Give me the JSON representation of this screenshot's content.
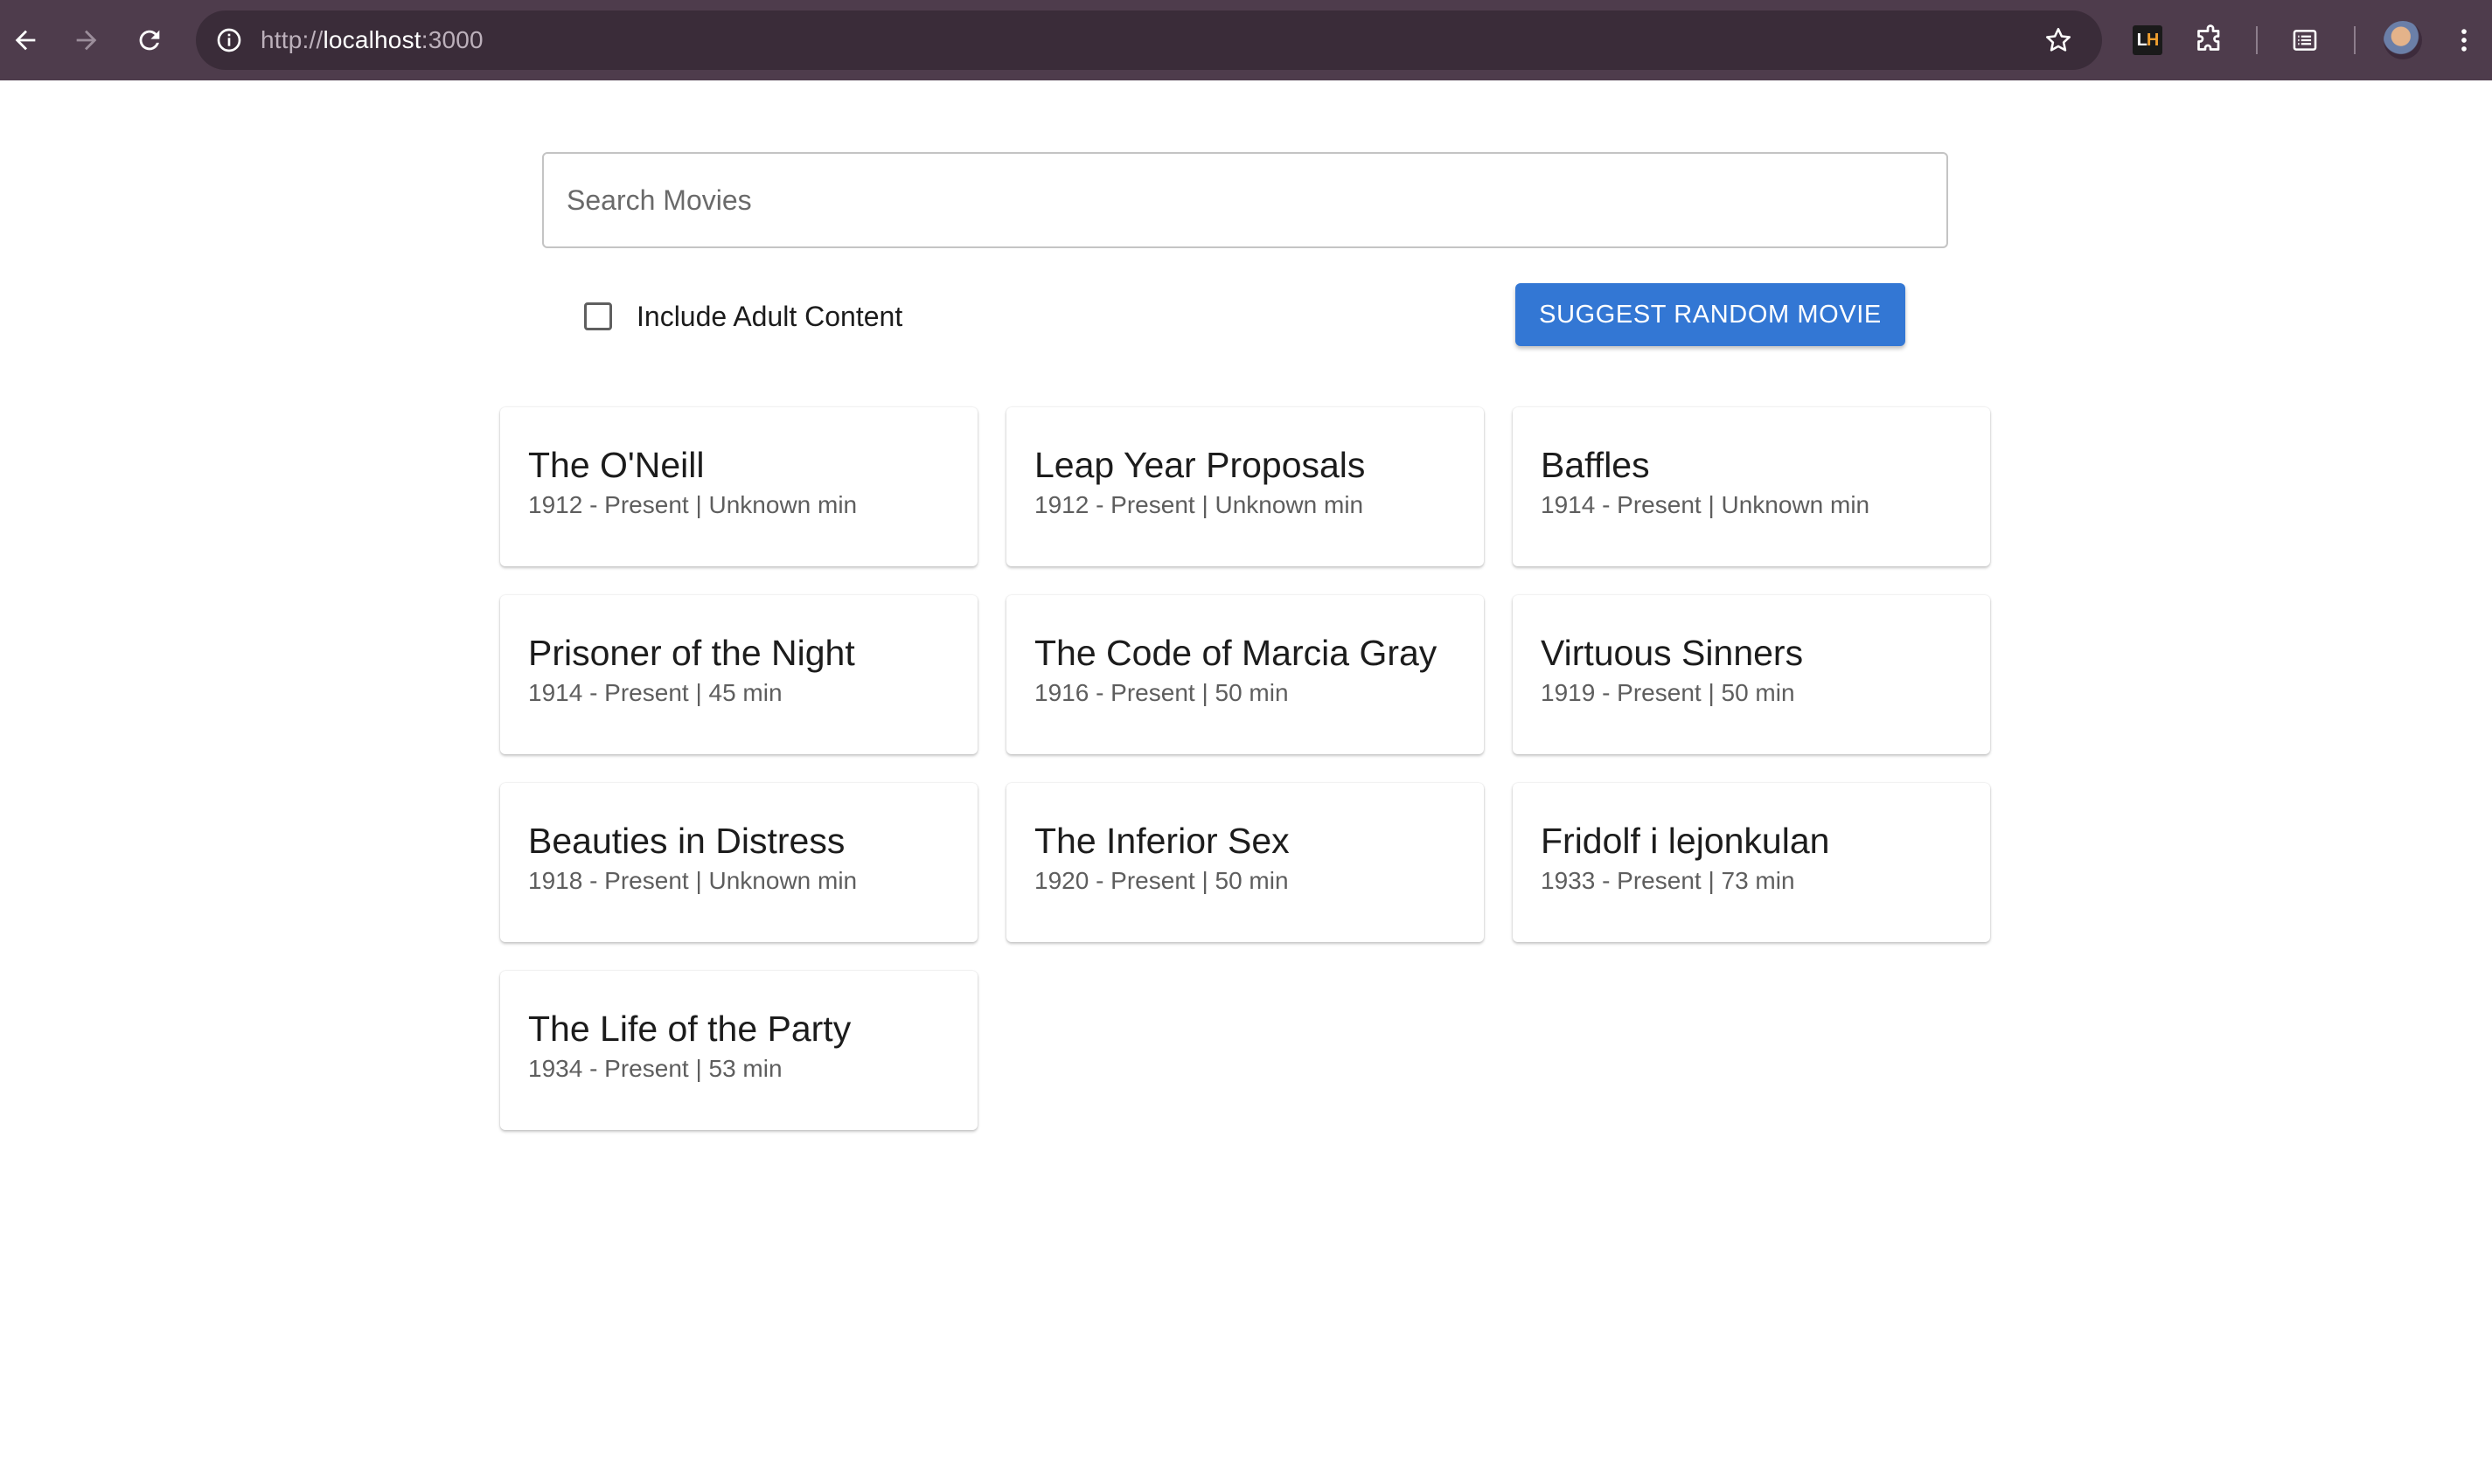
{
  "browser": {
    "url_prefix": "http://",
    "url_host": "localhost",
    "url_suffix": ":3000"
  },
  "search": {
    "placeholder": "Search Movies",
    "value": ""
  },
  "filters": {
    "adult_label": "Include Adult Content",
    "adult_checked": false
  },
  "actions": {
    "suggest_label": "SUGGEST RANDOM MOVIE"
  },
  "colors": {
    "chrome": "#4e3c4c",
    "primary_button": "#3377d4"
  },
  "movies": [
    {
      "title": "The O'Neill",
      "meta": "1912 - Present | Unknown min"
    },
    {
      "title": "Leap Year Proposals",
      "meta": "1912 - Present | Unknown min"
    },
    {
      "title": "Baffles",
      "meta": "1914 - Present | Unknown min"
    },
    {
      "title": "Prisoner of the Night",
      "meta": "1914 - Present | 45 min"
    },
    {
      "title": "The Code of Marcia Gray",
      "meta": "1916 - Present | 50 min"
    },
    {
      "title": "Virtuous Sinners",
      "meta": "1919 - Present | 50 min"
    },
    {
      "title": "Beauties in Distress",
      "meta": "1918 - Present | Unknown min"
    },
    {
      "title": "The Inferior Sex",
      "meta": "1920 - Present | 50 min"
    },
    {
      "title": "Fridolf i lejonkulan",
      "meta": "1933 - Present | 73 min"
    },
    {
      "title": "The Life of the Party",
      "meta": "1934 - Present | 53 min"
    }
  ]
}
